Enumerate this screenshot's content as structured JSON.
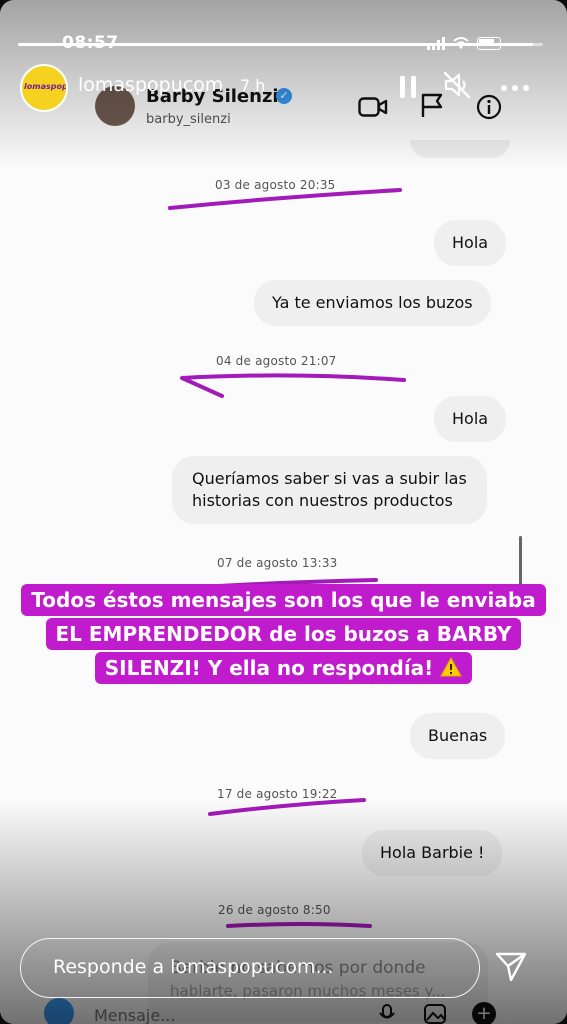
{
  "status_bar": {
    "time": "08:57"
  },
  "story": {
    "account": "lomaspopucom",
    "age": "7 h",
    "progress": 0.98,
    "reply_placeholder": "Responde a lomaspopucom..."
  },
  "dm": {
    "contact_name": "Barby Silenzi",
    "contact_handle": "barby_silenzi",
    "compose_placeholder": "Mensaje..."
  },
  "messages": [
    {
      "type": "timestamp",
      "text": "03 de agosto 20:35"
    },
    {
      "type": "sent",
      "text": "Hola"
    },
    {
      "type": "sent",
      "text": "Ya te enviamos los buzos"
    },
    {
      "type": "timestamp",
      "text": "04 de agosto 21:07"
    },
    {
      "type": "sent",
      "text": "Hola"
    },
    {
      "type": "sent",
      "lines": [
        "Queríamos saber si vas a subir las",
        "historias con nuestros productos"
      ]
    },
    {
      "type": "timestamp",
      "text": "07 de agosto 13:33"
    },
    {
      "type": "sent",
      "text": "Buenas"
    },
    {
      "type": "timestamp",
      "text": "17 de agosto 19:22"
    },
    {
      "type": "sent",
      "text": "Hola Barbie !"
    },
    {
      "type": "timestamp",
      "text": "26 de agosto 8:50"
    },
    {
      "type": "sent_partial",
      "lines": [
        "Barbie no sabemos por donde",
        "hablarte, pasaron muchos meses y..."
      ]
    }
  ],
  "caption": {
    "lines": [
      "Todos éstos mensajes son los que le enviaba",
      "EL EMPRENDEDOR de los buzos a BARBY",
      "SILENZI! Y ella no respondía!"
    ],
    "highlight_color": "#c01ccd",
    "annotation_color": "#a21ab8"
  },
  "icons": {
    "pause": "pause-icon",
    "mute": "speaker-muted-icon",
    "more": "more-icon",
    "video": "video-camera-icon",
    "flag": "flag-icon",
    "info": "info-icon",
    "send": "send-icon",
    "warning": "warning-icon"
  }
}
